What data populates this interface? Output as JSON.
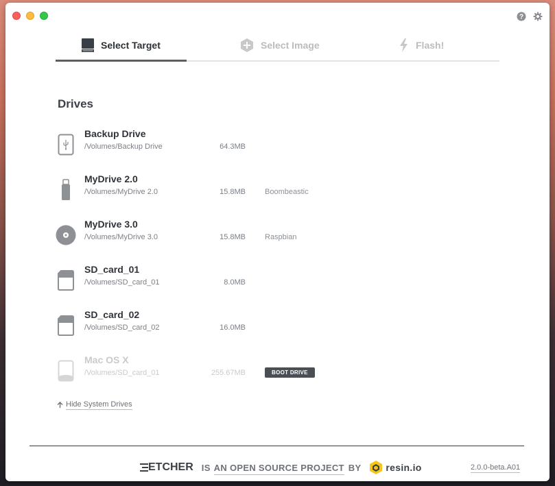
{
  "window": {
    "controls": [
      "close",
      "minimize",
      "maximize"
    ],
    "top_icons": [
      "help-icon",
      "gear-icon"
    ]
  },
  "steps": [
    {
      "label": "Select Target",
      "icon": "drive-icon",
      "active": true
    },
    {
      "label": "Select Image",
      "icon": "plus-hexagon-icon",
      "active": false
    },
    {
      "label": "Flash!",
      "icon": "lightning-icon",
      "active": false
    }
  ],
  "drives_section": {
    "title": "Drives",
    "items": [
      {
        "name": "Backup Drive",
        "path": "/Volumes/Backup Drive",
        "size": "64.3MB",
        "label": "",
        "icon": "usb-drive-icon",
        "enabled": true
      },
      {
        "name": "MyDrive 2.0",
        "path": "/Volumes/MyDrive 2.0",
        "size": "15.8MB",
        "label": "Boombeastic",
        "icon": "usb-stick-icon",
        "enabled": true
      },
      {
        "name": "MyDrive 3.0",
        "path": "/Volumes/MyDrive 3.0",
        "size": "15.8MB",
        "label": "Raspbian",
        "icon": "disc-icon",
        "enabled": true
      },
      {
        "name": "SD_card_01",
        "path": "/Volumes/SD_card_01",
        "size": "8.0MB",
        "label": "",
        "icon": "sd-card-icon",
        "enabled": true
      },
      {
        "name": "SD_card_02",
        "path": "/Volumes/SD_card_02",
        "size": "16.0MB",
        "label": "",
        "icon": "sd-card-icon",
        "enabled": true
      },
      {
        "name": "Mac OS X",
        "path": "/Volumes/SD_card_01",
        "size": "255.67MB",
        "label": "BOOT DRIVE",
        "icon": "hard-drive-icon",
        "enabled": false
      }
    ],
    "hide_link": "Hide System Drives"
  },
  "footer": {
    "logo": "ETCHER",
    "text_prefix": "IS",
    "text_link": "AN OPEN SOURCE PROJECT",
    "text_by": "BY",
    "brand": "resin.io",
    "version": "2.0.0-beta.A01"
  },
  "colors": {
    "active_step": "#2d3136",
    "inactive_step": "#bcbcbc",
    "badge_bg": "#4a4f56",
    "resin_yellow": "#f5c518"
  }
}
